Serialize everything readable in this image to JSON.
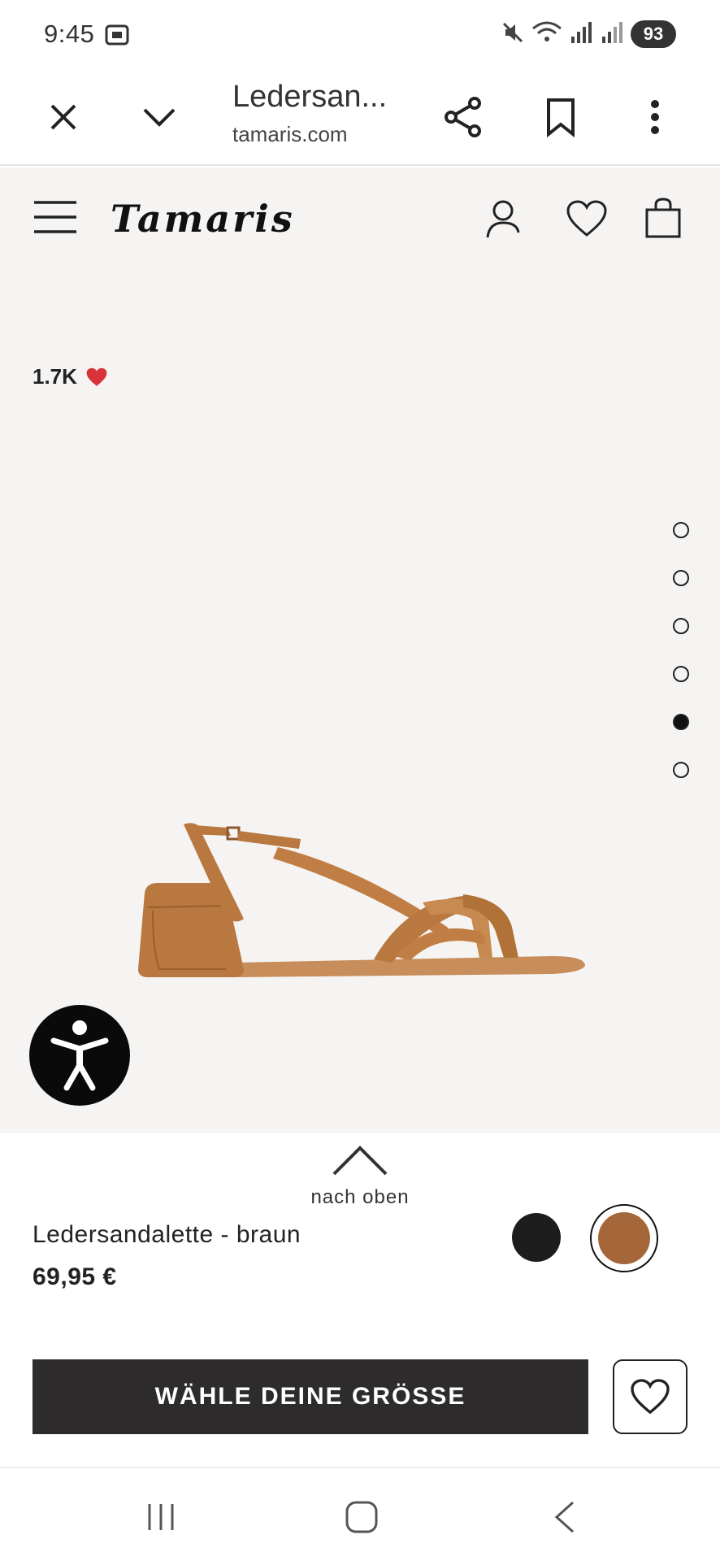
{
  "status_bar": {
    "time": "9:45",
    "battery": "93"
  },
  "browser": {
    "title": "Ledersan...",
    "url": "tamaris.com"
  },
  "site": {
    "logo": "Tamaris"
  },
  "product": {
    "likes": "1.7K",
    "name": "Ledersandalette - braun",
    "price": "69,95 €",
    "image_count": 6,
    "active_image_index": 4,
    "colors": {
      "swatch_black": "#1d1d1d",
      "swatch_brown": "#a5673a",
      "heart_red": "#d8333a"
    }
  },
  "actions": {
    "to_top_label": "nach oben",
    "size_button_label": "WÄHLE DEINE GRÖSSE"
  }
}
